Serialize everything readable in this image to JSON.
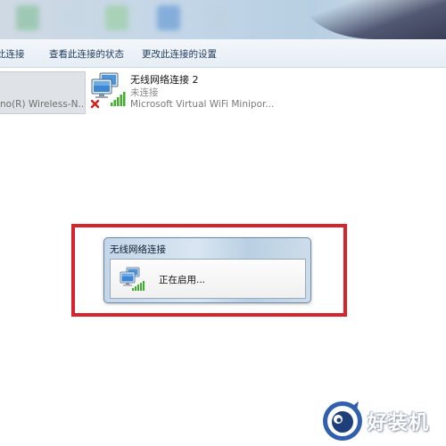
{
  "toolbar": {
    "item_disable": "此连接",
    "item_status": "查看此连接的状态",
    "item_settings": "更改此连接的设置"
  },
  "connections": {
    "left_adapter_partial": "no(R) Wireless-N...",
    "item": {
      "name": "无线网络连接 2",
      "status": "未连接",
      "adapter": "Microsoft Virtual WiFi Minipor..."
    }
  },
  "dialog": {
    "title": "无线网络连接",
    "message": "正在启用..."
  },
  "watermark": {
    "text": "好装机"
  },
  "colors": {
    "highlight": "#d9232c",
    "toolbar_text": "#1e3b5c",
    "error_x": "#d21f1f",
    "signal": "#3fae2a"
  },
  "icons": {
    "network_adapter": "monitor-network-icon",
    "disconnected": "red-x-icon",
    "signal_bars": "signal-bars-icon"
  }
}
